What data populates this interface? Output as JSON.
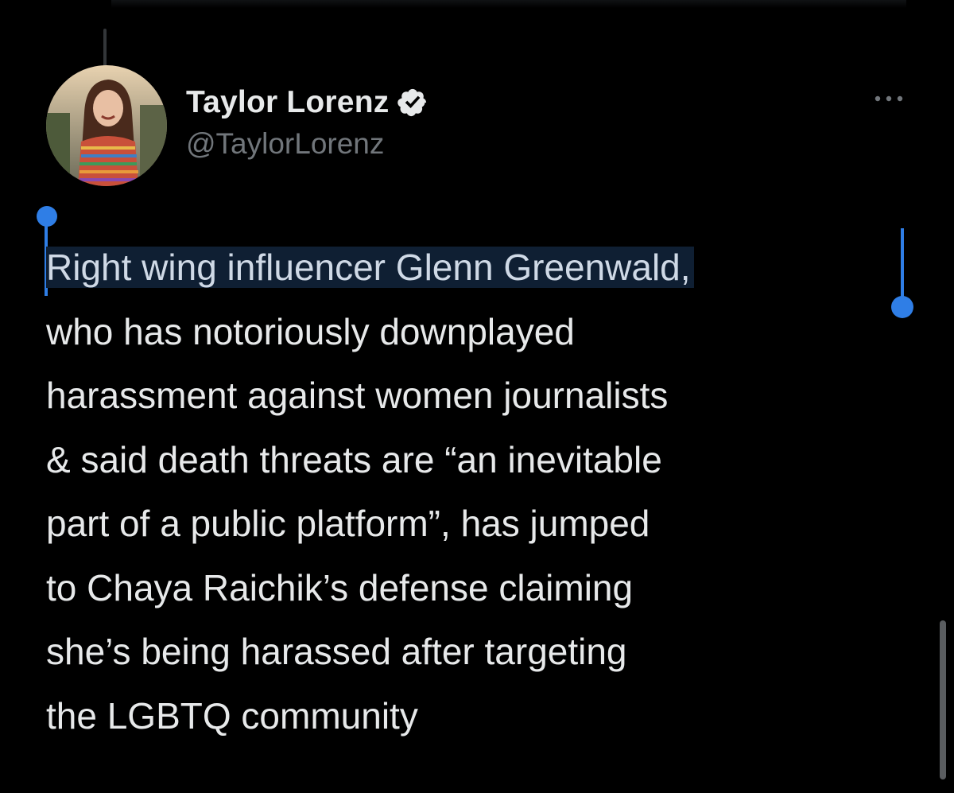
{
  "tweet": {
    "author": {
      "display_name": "Taylor Lorenz",
      "handle": "@TaylorLorenz",
      "verified": true
    },
    "text_lines": [
      "Right wing influencer Glenn Greenwald,",
      "who has notoriously downplayed",
      "harassment against women journalists",
      "& said death threats are “an inevitable",
      "part of a public platform”, has jumped",
      "to Chaya Raichik’s defense claiming",
      "she’s being harassed after targeting",
      "the LGBTQ community"
    ],
    "selected_text": "Right wing influencer Glenn Greenwald,"
  },
  "icons": {
    "verified": "verified-badge-icon",
    "more": "more-options-icon"
  },
  "colors": {
    "background": "#000000",
    "text_primary": "#e7e9ea",
    "text_secondary": "#71767b",
    "selection_highlight": "#0f1f33",
    "selection_handle": "#2f7ee6"
  }
}
